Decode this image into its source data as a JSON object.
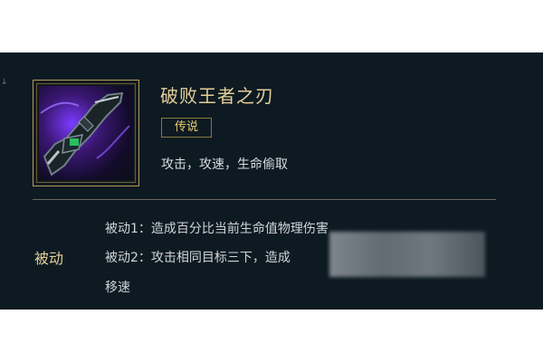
{
  "item": {
    "name": "破败王者之刃",
    "rarity": "传说",
    "stats": "攻击，攻速，生命偷取",
    "icon": "sword-item-icon"
  },
  "passive": {
    "label": "被动",
    "lines": [
      "被动1：造成百分比当前生命值物理伤害",
      "被动2：攻击相同目标三下，造成",
      "移速"
    ]
  },
  "colors": {
    "panel_bg": "#0d1a22",
    "gold": "#e3cf98",
    "rarity": "#e8cf6a",
    "text": "#d7dde0"
  }
}
